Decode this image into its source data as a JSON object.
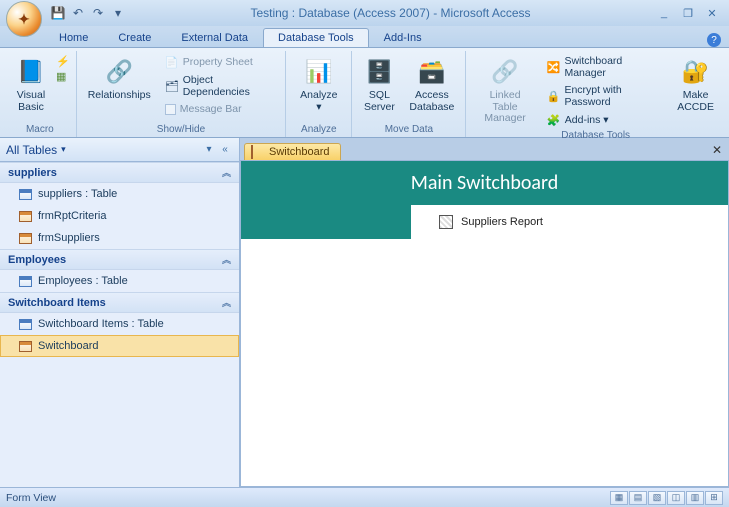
{
  "title": "Testing : Database (Access 2007) - Microsoft Access",
  "tabs": {
    "home": "Home",
    "create": "Create",
    "external": "External Data",
    "dbtools": "Database Tools",
    "addins": "Add-Ins"
  },
  "ribbon": {
    "macro": {
      "vb": "Visual\nBasic",
      "label": "Macro"
    },
    "showhide": {
      "rel": "Relationships",
      "propsheet": "Property Sheet",
      "objdep": "Object Dependencies",
      "msgbar": "Message Bar",
      "label": "Show/Hide"
    },
    "analyze": {
      "btn": "Analyze",
      "label": "Analyze"
    },
    "movedata": {
      "sql": "SQL\nServer",
      "access": "Access\nDatabase",
      "label": "Move Data"
    },
    "linked": {
      "btn": "Linked Table\nManager"
    },
    "dbtools": {
      "sbm": "Switchboard Manager",
      "enc": "Encrypt with Password",
      "addins": "Add-ins",
      "accde": "Make\nACCDE",
      "label": "Database Tools"
    }
  },
  "nav": {
    "header": "All Tables",
    "groups": [
      {
        "name": "suppliers",
        "items": [
          {
            "label": "suppliers : Table",
            "type": "table"
          },
          {
            "label": "frmRptCriteria",
            "type": "form"
          },
          {
            "label": "frmSuppliers",
            "type": "form"
          }
        ]
      },
      {
        "name": "Employees",
        "items": [
          {
            "label": "Employees : Table",
            "type": "table"
          }
        ]
      },
      {
        "name": "Switchboard Items",
        "items": [
          {
            "label": "Switchboard Items : Table",
            "type": "table"
          },
          {
            "label": "Switchboard",
            "type": "form",
            "selected": true
          }
        ]
      }
    ]
  },
  "doc": {
    "tab": "Switchboard",
    "title": "Main Switchboard",
    "item1": "Suppliers Report"
  },
  "status": {
    "text": "Form View"
  }
}
